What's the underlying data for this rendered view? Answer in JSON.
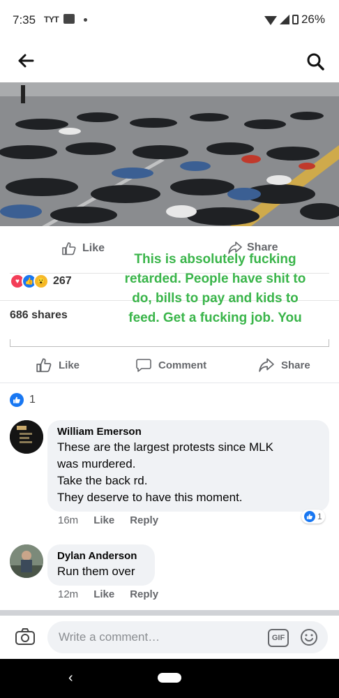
{
  "status_bar": {
    "time": "7:35",
    "app_badge": "TYT",
    "battery": "26%"
  },
  "app_bar": {
    "back_icon": "back-arrow-icon",
    "search_icon": "search-icon"
  },
  "shared_image": {
    "inner_post": {
      "like_label": "Like",
      "share_label": "Share",
      "reaction_count": "267",
      "shares_label": "686 shares"
    },
    "overlay_text": "This is absolutely fucking retarded. People have shit to do, bills to pay and kids to feed. Get a fucking job. You"
  },
  "actions": {
    "like_label": "Like",
    "comment_label": "Comment",
    "share_label": "Share"
  },
  "likes": {
    "count": "1"
  },
  "comments": [
    {
      "name": "William Emerson",
      "lines": [
        "These are the largest protests since MLK",
        "was murdered.",
        "Take the back rd.",
        "They deserve to have this moment."
      ],
      "time": "16m",
      "like_label": "Like",
      "reply_label": "Reply",
      "reaction_count": "1"
    },
    {
      "name": "Dylan Anderson",
      "lines": [
        "Run them over"
      ],
      "time": "12m",
      "like_label": "Like",
      "reply_label": "Reply"
    }
  ],
  "composer": {
    "placeholder": "Write a comment…",
    "gif_label": "GIF"
  },
  "nav": {
    "back_glyph": "‹"
  },
  "colors": {
    "overlay_text": "#3ab54a",
    "facebook_blue": "#1877f2",
    "bubble": "#f0f2f5"
  }
}
